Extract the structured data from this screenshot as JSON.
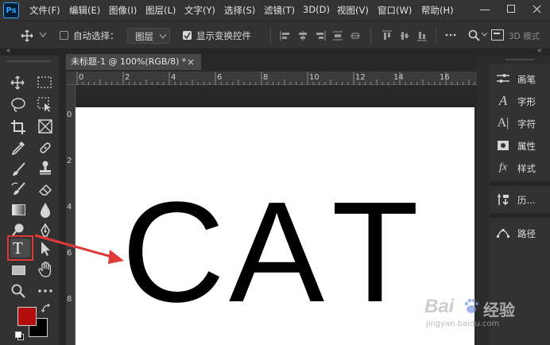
{
  "app": {
    "logo": "Ps"
  },
  "menu": [
    "文件(F)",
    "编辑(E)",
    "图像(I)",
    "图层(L)",
    "文字(Y)",
    "选择(S)",
    "滤镜(T)",
    "3D(D)",
    "视图(V)",
    "窗口(W)",
    "帮助(H)"
  ],
  "options": {
    "auto_select_label": "自动选择：",
    "auto_select_checked": false,
    "layer_dropdown_value": "图层",
    "show_transform_label": "显示变换控件",
    "show_transform_checked": true,
    "mode_label": "3D 模式"
  },
  "document": {
    "tab_title": "未标题-1 @ 100%(RGB/8) *",
    "close_glyph": "×",
    "ruler_top_labels": [
      "0",
      "2",
      "4",
      "6",
      "8",
      "10",
      "12",
      "14",
      "16"
    ],
    "ruler_left_labels": [
      "0",
      "2",
      "4",
      "6",
      "8"
    ],
    "canvas_text": [
      "C",
      "A",
      "T"
    ]
  },
  "colors": {
    "foreground": "#b30d0d",
    "background": "#000000",
    "highlight": "#e0393a"
  },
  "toolbar": {
    "tools": [
      "move-icon",
      "marquee-icon",
      "lasso-icon",
      "object-select-icon",
      "crop-icon",
      "frame-icon",
      "eyedropper-icon",
      "healing-icon",
      "brush-icon",
      "stamp-icon",
      "history-brush-icon",
      "eraser-icon",
      "gradient-icon",
      "blur-icon",
      "dodge-icon",
      "pen-icon",
      "type-icon",
      "path-select-icon",
      "rectangle-icon",
      "hand-icon",
      "zoom-icon",
      "more-icon"
    ],
    "type_tool_glyph": "T"
  },
  "panels": [
    {
      "icon": "brush-settings-icon",
      "label": "画笔"
    },
    {
      "icon": "character-icon",
      "label": "字形"
    },
    {
      "icon": "paragraph-icon",
      "label": "字符"
    },
    {
      "icon": "properties-icon",
      "label": "属性"
    },
    {
      "icon": "styles-icon",
      "label": "样式"
    },
    {
      "icon": "history-icon",
      "label": "历..."
    },
    {
      "icon": "paths-icon",
      "label": "路径"
    }
  ],
  "watermark": {
    "brand": "Bai",
    "brand_cn": "经验",
    "url": "jingyan.baidu.com"
  }
}
